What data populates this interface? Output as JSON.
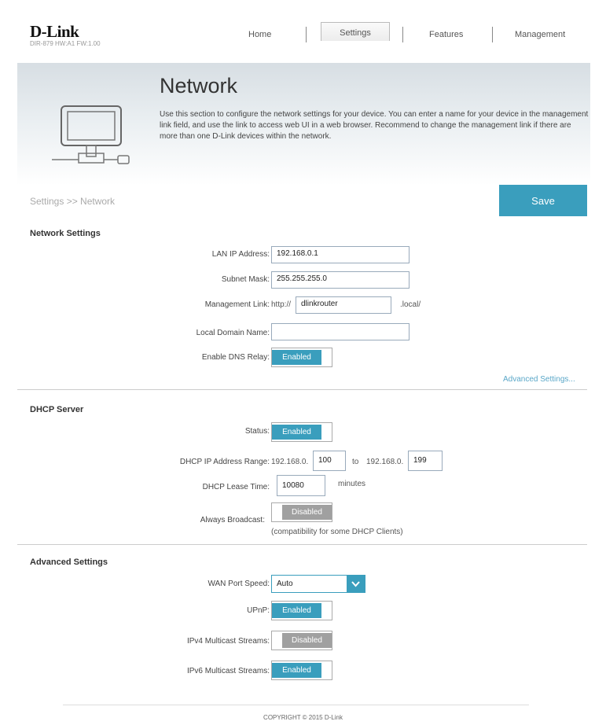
{
  "header": {
    "brand": "D-Link",
    "model": "DIR-879 HW:A1 FW:1.00",
    "nav": [
      "Home",
      "Settings",
      "Features",
      "Management"
    ]
  },
  "banner": {
    "title": "Network",
    "description": "Use this section to configure the network settings for your device. You can enter a name for your device in the management link field, and use the link to access web UI in a web browser. Recommend to change the management link if there are more than one D-Link devices within the network."
  },
  "breadcrumb": "Settings >> Network",
  "save_label": "Save",
  "network_settings": {
    "title": "Network Settings",
    "lan_ip_label": "LAN IP Address:",
    "lan_ip_value": "192.168.0.1",
    "subnet_label": "Subnet Mask:",
    "subnet_value": "255.255.255.0",
    "mgmt_label": "Management Link:",
    "mgmt_prefix": "http://",
    "mgmt_value": "dlinkrouter",
    "mgmt_suffix": ".local/",
    "domain_label": "Local Domain Name:",
    "domain_value": "",
    "dns_relay_label": "Enable DNS Relay:",
    "dns_relay_state": "Enabled",
    "advanced_link": "Advanced Settings..."
  },
  "dhcp_server": {
    "title": "DHCP Server",
    "status_label": "Status:",
    "status_state": "Enabled",
    "range_label": "DHCP IP Address Range:",
    "range_prefix_start": "192.168.0.",
    "range_start": "100",
    "range_to": "to",
    "range_prefix_end": "192.168.0.",
    "range_end": "199",
    "lease_label": "DHCP Lease Time:",
    "lease_value": "10080",
    "lease_unit": "minutes",
    "broadcast_label": "Always Broadcast:",
    "broadcast_state": "Disabled",
    "broadcast_note": "(compatibility for some DHCP Clients)"
  },
  "advanced_settings": {
    "title": "Advanced Settings",
    "wan_label": "WAN Port Speed:",
    "wan_value": "Auto",
    "upnp_label": "UPnP:",
    "upnp_state": "Enabled",
    "ipv4_label": "IPv4 Multicast Streams:",
    "ipv4_state": "Disabled",
    "ipv6_label": "IPv6 Multicast Streams:",
    "ipv6_state": "Enabled"
  },
  "footer": {
    "copyright": "COPYRIGHT © 2015 D-Link"
  },
  "colors": {
    "accent": "#3a9ebd",
    "disabled": "#a0a0a0",
    "banner_top": "#d7dee3"
  },
  "icons": {
    "network": "computer-network-icon",
    "dropdown": "chevron-down-icon"
  }
}
